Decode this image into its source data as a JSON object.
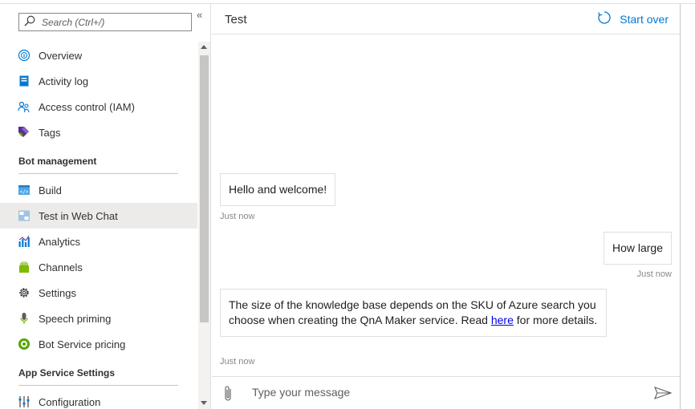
{
  "search": {
    "placeholder": "Search (Ctrl+/)"
  },
  "collapse_glyph": "«",
  "sidebar": {
    "top_items": [
      {
        "label": "Overview",
        "icon": "info-icon"
      },
      {
        "label": "Activity log",
        "icon": "activity-log-icon"
      },
      {
        "label": "Access control (IAM)",
        "icon": "people-icon"
      },
      {
        "label": "Tags",
        "icon": "tag-icon"
      }
    ],
    "bot_management": {
      "heading": "Bot management",
      "items": [
        {
          "label": "Build",
          "icon": "code-icon"
        },
        {
          "label": "Test in Web Chat",
          "icon": "web-chat-icon",
          "active": true
        },
        {
          "label": "Analytics",
          "icon": "analytics-icon"
        },
        {
          "label": "Channels",
          "icon": "channels-icon"
        },
        {
          "label": "Settings",
          "icon": "gear-icon"
        },
        {
          "label": "Speech priming",
          "icon": "microphone-icon"
        },
        {
          "label": "Bot Service pricing",
          "icon": "pricing-icon"
        }
      ]
    },
    "app_service": {
      "heading": "App Service Settings",
      "items": [
        {
          "label": "Configuration",
          "icon": "configuration-icon"
        }
      ]
    }
  },
  "chat": {
    "title": "Test",
    "start_over": "Start over",
    "messages": [
      {
        "from": "bot",
        "text": "Hello and welcome!",
        "time": "Just now"
      },
      {
        "from": "user",
        "text": "How large",
        "time": "Just now"
      },
      {
        "from": "bot",
        "text_before": "The size of the knowledge base depends on the SKU of Azure search you choose when creating the QnA Maker service. Read ",
        "link": "here",
        "text_after": " for more details.",
        "time": "Just now"
      }
    ],
    "input_placeholder": "Type your message"
  },
  "colors": {
    "accent": "#0078d4",
    "active_bg": "#edebe9"
  }
}
